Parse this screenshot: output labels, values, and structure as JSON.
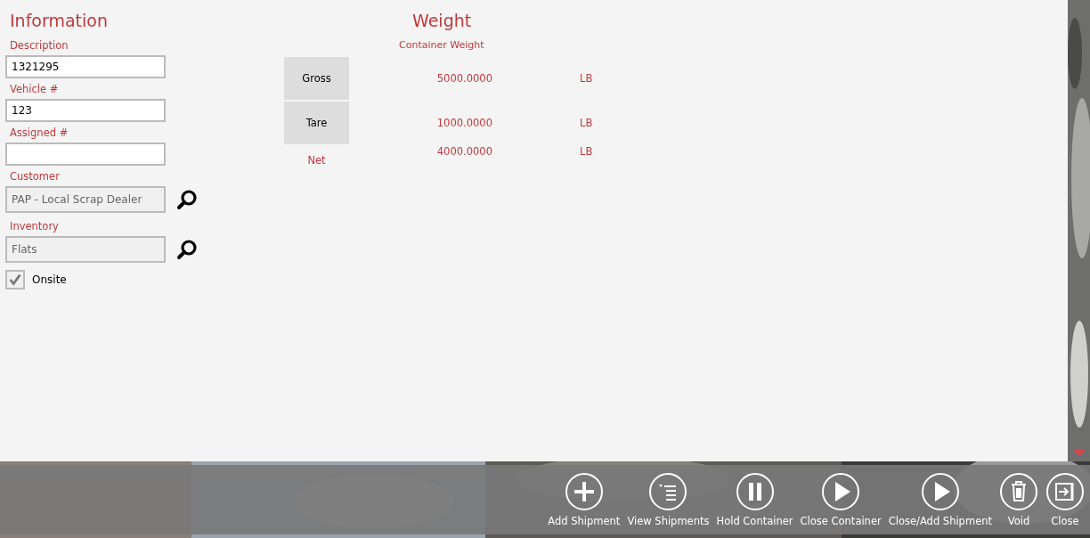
{
  "information": {
    "title": "Information",
    "fields": [
      {
        "label": "Description",
        "value": "1321295",
        "kind": "text"
      },
      {
        "label": "Vehicle #",
        "value": "123",
        "kind": "text"
      },
      {
        "label": "Assigned #",
        "kind": "text"
      },
      {
        "label": "Customer",
        "value": "PAP - Local Scrap Dealer",
        "kind": "lookup"
      },
      {
        "label": "Inventory",
        "value": "Flats",
        "kind": "lookup"
      }
    ],
    "onsite": {
      "label": "Onsite",
      "checked": true
    }
  },
  "weight": {
    "title": "Weight",
    "subtitle": "Container Weight",
    "rows": [
      {
        "label": "Gross",
        "kind": "button",
        "value": "5000.0000",
        "unit": "LB"
      },
      {
        "label": "Tare",
        "kind": "button",
        "value": "1000.0000",
        "unit": "LB"
      },
      {
        "label": "Net",
        "kind": "label",
        "value": "4000.0000",
        "unit": "LB"
      }
    ]
  },
  "app_bar": [
    {
      "label": "Add Shipment",
      "kind": "plus"
    },
    {
      "label": "View Shipments",
      "kind": "list"
    },
    {
      "label": "Hold Container",
      "kind": "pause"
    },
    {
      "label": "Close Container",
      "kind": "play"
    },
    {
      "label": "Close/Add Shipment",
      "kind": "play"
    },
    {
      "label": "Void",
      "kind": "trash"
    },
    {
      "label": "Close",
      "kind": "exit"
    }
  ]
}
